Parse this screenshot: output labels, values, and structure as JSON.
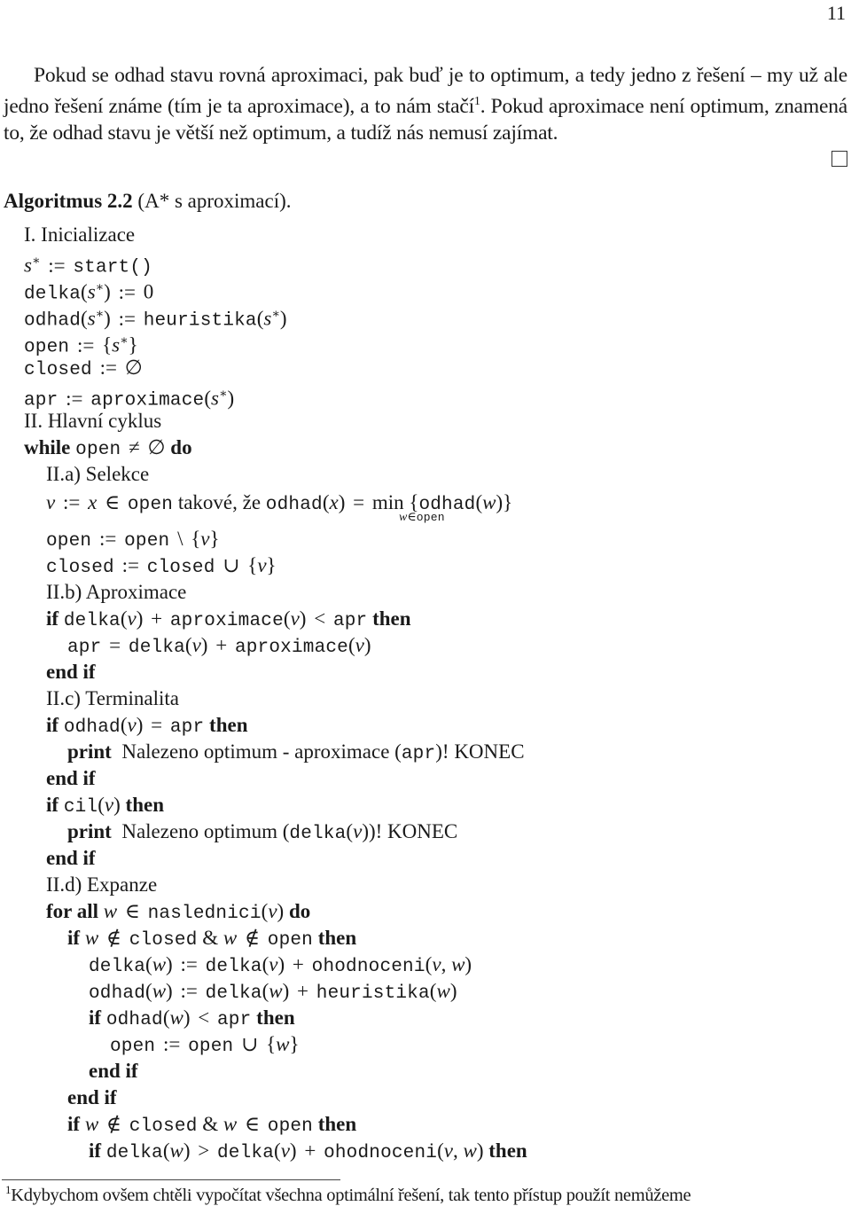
{
  "page_number": "11",
  "paragraph": {
    "text_before_footnote": "Pokud se odhad stavu rovná aproximaci, pak buď je to optimum, a tedy jedno z řešení – my už ale jedno řešení známe (tím je ta aproximace), a to nám stačí",
    "footnote_mark": "1",
    "text_after_footnote": ". Pokud aproximace není optimum, znamená to, že odhad stavu je větší než optimum, a tudíž nás nemusí zajímat."
  },
  "algorithm": {
    "label": "Algoritmus 2.2",
    "caption": "(A* s aproximací)."
  },
  "lines": {
    "init_heading": "I. Inicializace",
    "s_star": "s",
    "star": "∗",
    "assign": ":=",
    "start_fn": "start()",
    "delka": "delka",
    "zero": "0",
    "odhad": "odhad",
    "heuristika": "heuristika",
    "open": "open",
    "closed": "closed",
    "empty": "∅",
    "apr": "apr",
    "aproximace": "aproximace",
    "main_heading": "II. Hlavní cyklus",
    "kw_while": "while",
    "kw_do": "do",
    "neq": "≠",
    "sel_heading": "II.a) Selekce",
    "v": "v",
    "x": "x",
    "w": "w",
    "in": "∈",
    "notin": "∉",
    "takove": "takové, že",
    "min": "min",
    "setminus": "\\",
    "union": "∪",
    "aprox_heading": "II.b) Aproximace",
    "kw_if": "if",
    "kw_then": "then",
    "kw_end_if": "end if",
    "kw_print": "print",
    "lt": "<",
    "gt": ">",
    "plus": "+",
    "eq": "=",
    "term_heading": "II.c) Terminalita",
    "print1_text_a": "Nalezeno optimum - aproximace (",
    "print1_text_b": ")! KONEC",
    "cil": "cil",
    "print2_text_a": "Nalezeno optimum (",
    "print2_text_b": ")! KONEC",
    "exp_heading": "II.d) Expanze",
    "kw_for_all": "for all",
    "naslednici": "naslednici",
    "ohodnoceni": "ohodnoceni",
    "amp": "&"
  },
  "footnote": {
    "mark": "1",
    "text": "Kdybychom ovšem chtěli vypočítat všechna optimální řešení, tak tento přístup použít nemůžeme"
  }
}
